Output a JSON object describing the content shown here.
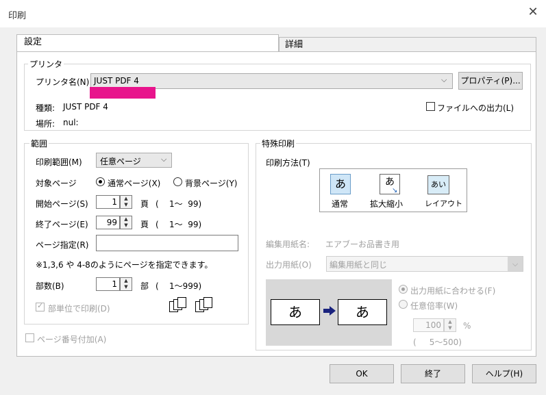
{
  "window": {
    "title": "印刷",
    "close_glyph": "✕"
  },
  "tabs": [
    {
      "label": "設定"
    },
    {
      "label": "詳細"
    }
  ],
  "printer": {
    "group_label": "プリンタ",
    "name_label": "プリンタ名(N)",
    "name_value": "JUST PDF 4",
    "properties_button": "プロパティ(P)...",
    "type_label": "種類:",
    "type_value": "JUST PDF 4",
    "location_label": "場所:",
    "location_value": "nul:",
    "file_output_label": "ファイルへの出力(L)",
    "highlight_color": "#e8148c"
  },
  "range": {
    "group_label": "範囲",
    "print_range_label": "印刷範囲(M)",
    "print_range_value": "任意ページ",
    "target_label": "対象ページ",
    "normal_page": "通常ページ(X)",
    "background_page": "背景ページ(Y)",
    "start_label": "開始ページ(S)",
    "start_value": "1",
    "start_unit": "頁",
    "start_range": "(    1～  99)",
    "end_label": "終了ページ(E)",
    "end_value": "99",
    "end_unit": "頁",
    "end_range": "(    1～  99)",
    "page_spec_label": "ページ指定(R)",
    "page_spec_value": "",
    "note": "※1,3,6 や 4-8のようにページを指定できます。",
    "copies_label": "部数(B)",
    "copies_value": "1",
    "copies_unit": "部",
    "copies_range": "(    1～999)",
    "collate_label": "部単位で印刷(D)"
  },
  "page_number_label": "ページ番号付加(A)",
  "special": {
    "group_label": "特殊印刷",
    "method_label": "印刷方法(T)",
    "methods": [
      {
        "icon_text": "あ",
        "label": "通常"
      },
      {
        "icon_text": "あ",
        "label": "拡大縮小"
      },
      {
        "icon_text": "あい",
        "label": "レイアウト"
      }
    ],
    "paper_name_label": "編集用紙名:",
    "paper_name_value": "エアブーお品書き用",
    "output_paper_label": "出力用紙(O)",
    "output_paper_value": "編集用紙と同じ",
    "preview_char": "あ",
    "fit_label": "出力用紙に合わせる(F)",
    "scale_label": "任意倍率(W)",
    "scale_value": "100",
    "scale_unit": "%",
    "scale_range": "(     5～500)"
  },
  "buttons": {
    "ok": "OK",
    "close": "終了",
    "help": "ヘルプ(H)"
  }
}
